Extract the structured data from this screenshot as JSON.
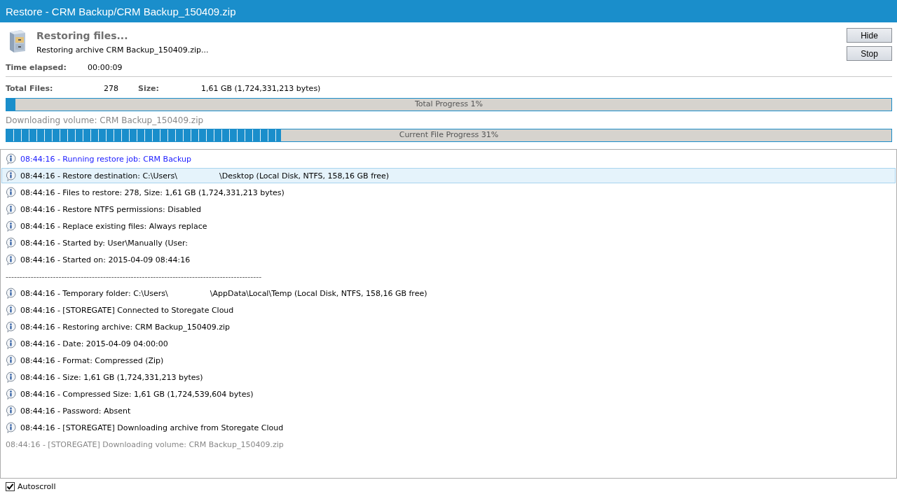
{
  "window": {
    "title": "Restore - CRM Backup/CRM Backup_150409.zip"
  },
  "header": {
    "title": "Restoring files...",
    "subtitle": "Restoring archive CRM Backup_150409.zip..."
  },
  "buttons": [
    {
      "label": "Hide"
    },
    {
      "label": "Stop"
    }
  ],
  "time_elapsed": {
    "label": "Time elapsed:",
    "value": "00:00:09"
  },
  "totals": {
    "files_label": "Total Files:",
    "files_value": "278",
    "size_label": "Size:",
    "size_value": "1,61 GB (1,724,331,213 bytes)"
  },
  "total_progress": {
    "label": "Total Progress 1%",
    "level": 0.01
  },
  "current_volume": "Downloading volume: CRM Backup_150409.zip",
  "current_progress": {
    "label": "Current File Progress 31%",
    "level": 0.31
  },
  "log": [
    {
      "kind": "job",
      "selected": false,
      "text": "08:44:16 - Running restore job: CRM Backup"
    },
    {
      "kind": "info",
      "selected": true,
      "text": "08:44:16 - Restore destination: C:\\Users\\",
      "text_after_gap": "\\Desktop (Local Disk, NTFS, 158,16 GB free)"
    },
    {
      "kind": "info",
      "selected": false,
      "text": "08:44:16 - Files to restore: 278, Size: 1,61 GB (1,724,331,213 bytes)"
    },
    {
      "kind": "info",
      "selected": false,
      "text": "08:44:16 - Restore NTFS permissions: Disabled"
    },
    {
      "kind": "info",
      "selected": false,
      "text": "08:44:16 - Replace existing files: Always replace"
    },
    {
      "kind": "info",
      "selected": false,
      "text": "08:44:16 - Started by: User\\Manually (User:"
    },
    {
      "kind": "info",
      "selected": false,
      "text": "08:44:16 - Started on: 2015-04-09 08:44:16"
    },
    {
      "kind": "separator",
      "selected": false,
      "text": "--------------------------------------------------------------------------------------------"
    },
    {
      "kind": "info",
      "selected": false,
      "text": "08:44:16 - Temporary folder: C:\\Users\\",
      "text_after_gap": "\\AppData\\Local\\Temp (Local Disk, NTFS, 158,16 GB free)"
    },
    {
      "kind": "info",
      "selected": false,
      "text": "08:44:16 - [STOREGATE] Connected to Storegate Cloud"
    },
    {
      "kind": "info",
      "selected": false,
      "text": "08:44:16 - Restoring archive: CRM Backup_150409.zip"
    },
    {
      "kind": "info",
      "selected": false,
      "text": "08:44:16 - Date: 2015-04-09 04:00:00"
    },
    {
      "kind": "info",
      "selected": false,
      "text": "08:44:16 - Format: Compressed (Zip)"
    },
    {
      "kind": "info",
      "selected": false,
      "text": "08:44:16 - Size: 1,61 GB (1,724,331,213 bytes)"
    },
    {
      "kind": "info",
      "selected": false,
      "text": "08:44:16 - Compressed Size: 1,61 GB (1,724,539,604 bytes)"
    },
    {
      "kind": "info",
      "selected": false,
      "text": "08:44:16 - Password: Absent"
    },
    {
      "kind": "info",
      "selected": false,
      "text": "08:44:16 - [STOREGATE] Downloading archive from Storegate Cloud"
    },
    {
      "kind": "pending",
      "selected": false,
      "text": "08:44:16 - [STOREGATE] Downloading volume: CRM Backup_150409.zip"
    }
  ],
  "autoscroll": {
    "label": "Autoscroll",
    "checked": true
  }
}
